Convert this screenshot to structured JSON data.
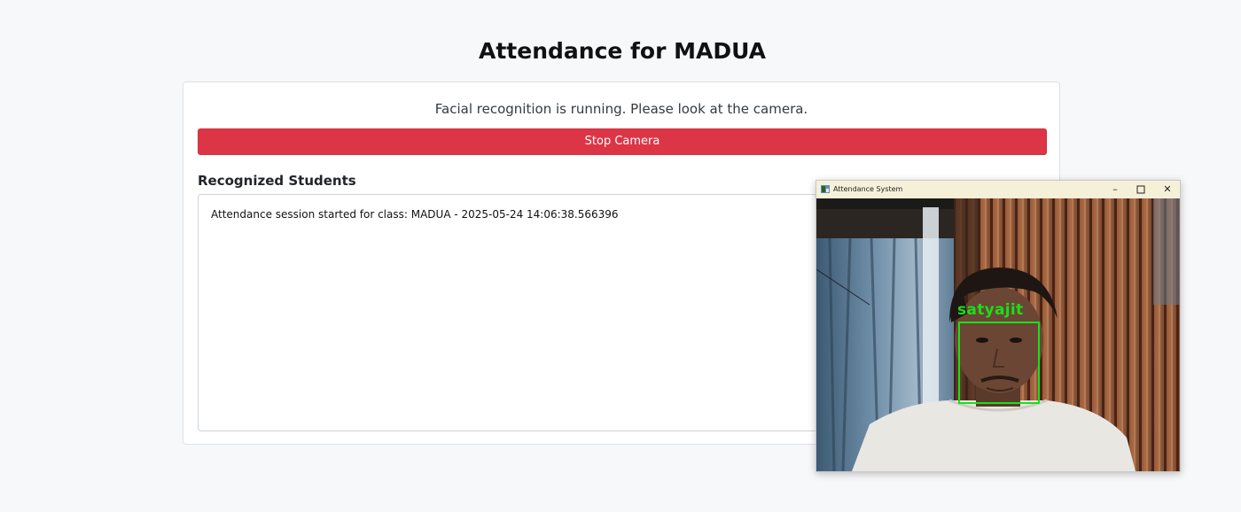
{
  "page": {
    "title": "Attendance for MADUA"
  },
  "card": {
    "status_text": "Facial recognition is running. Please look at the camera.",
    "stop_button_label": "Stop Camera",
    "section_heading": "Recognized Students",
    "log_entries": [
      "Attendance session started for class: MADUA - 2025-05-24 14:06:38.566396"
    ]
  },
  "camera_window": {
    "title": "Attendance System",
    "minimize_icon": "minimize-icon",
    "maximize_icon": "maximize-icon",
    "close_icon": "close-icon",
    "recognized_name": "satyajit"
  },
  "colors": {
    "stop_button": "#dc3545",
    "detection_box": "#19e019",
    "titlebar": "#f5f1d9"
  }
}
